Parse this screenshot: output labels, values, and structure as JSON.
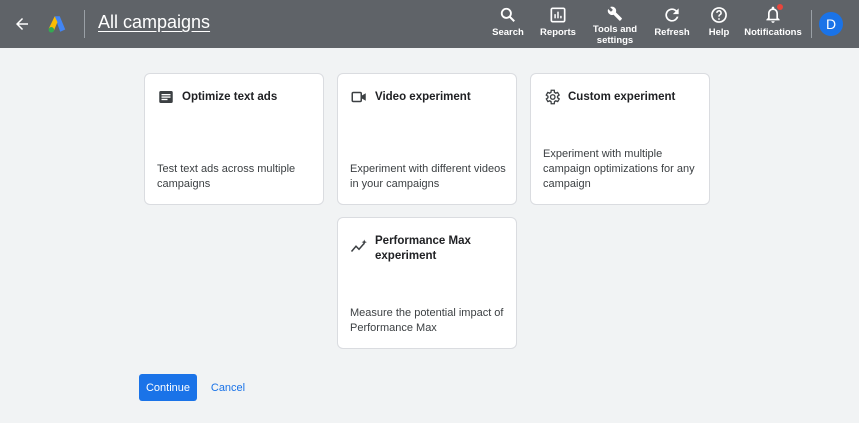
{
  "header": {
    "title": "All campaigns",
    "nav": {
      "search": "Search",
      "reports": "Reports",
      "tools_line1": "Tools and",
      "tools_line2": "settings",
      "refresh": "Refresh",
      "help": "Help",
      "notifications": "Notifications"
    },
    "avatar_initial": "D"
  },
  "cards": [
    {
      "title": "Optimize text ads",
      "description": "Test text ads across multiple campaigns",
      "icon": "text-ad-icon"
    },
    {
      "title": "Video experiment",
      "description": "Experiment with different videos in your campaigns",
      "icon": "video-camera-icon"
    },
    {
      "title": "Custom experiment",
      "description": "Experiment with multiple campaign optimizations for any campaign",
      "icon": "gear-icon"
    },
    {
      "title": "Performance Max experiment",
      "description": "Measure the potential impact of Performance Max",
      "icon": "performance-spark-icon"
    }
  ],
  "actions": {
    "continue_label": "Continue",
    "cancel_label": "Cancel"
  },
  "colors": {
    "topbar": "#5f6368",
    "background": "#f1f3f4",
    "primary": "#1a73e8",
    "notification_dot": "#e8453c"
  }
}
